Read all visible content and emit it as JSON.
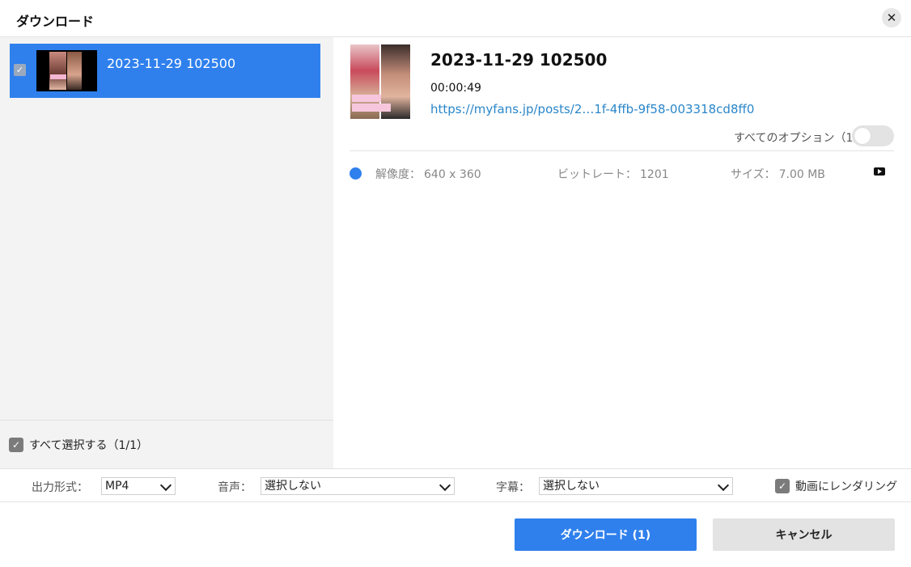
{
  "window": {
    "title": "ダウンロード"
  },
  "list": {
    "items": [
      {
        "title": "2023-11-29 102500",
        "checked": true
      }
    ],
    "select_all_label": "すべて選択する（1/1）"
  },
  "detail": {
    "title": "2023-11-29 102500",
    "duration": "00:00:49",
    "url": "https://myfans.jp/posts/2…1f-4ffb-9f58-003318cd8ff0",
    "all_options_label": "すべてのオプション（1）",
    "all_options_enabled": false,
    "format": {
      "resolution_label": "解像度：",
      "resolution_value": "640 x 360",
      "bitrate_label": "ビットレート：",
      "bitrate_value": "1201",
      "size_label": "サイズ：",
      "size_value": "7.00 MB",
      "source_icon": "youtube-icon"
    }
  },
  "options": {
    "output_format_label": "出力形式：",
    "output_format_value": "MP4",
    "audio_label": "音声：",
    "audio_value": "選択しない",
    "subtitle_label": "字幕：",
    "subtitle_value": "選択しない",
    "render_label": "動画にレンダリング",
    "render_checked": true
  },
  "buttons": {
    "download_label": "ダウンロード (1)",
    "cancel_label": "キャンセル"
  },
  "colors": {
    "accent": "#2f80ed",
    "link": "#2a86c9",
    "left_pane_bg": "#f3f3f3"
  }
}
